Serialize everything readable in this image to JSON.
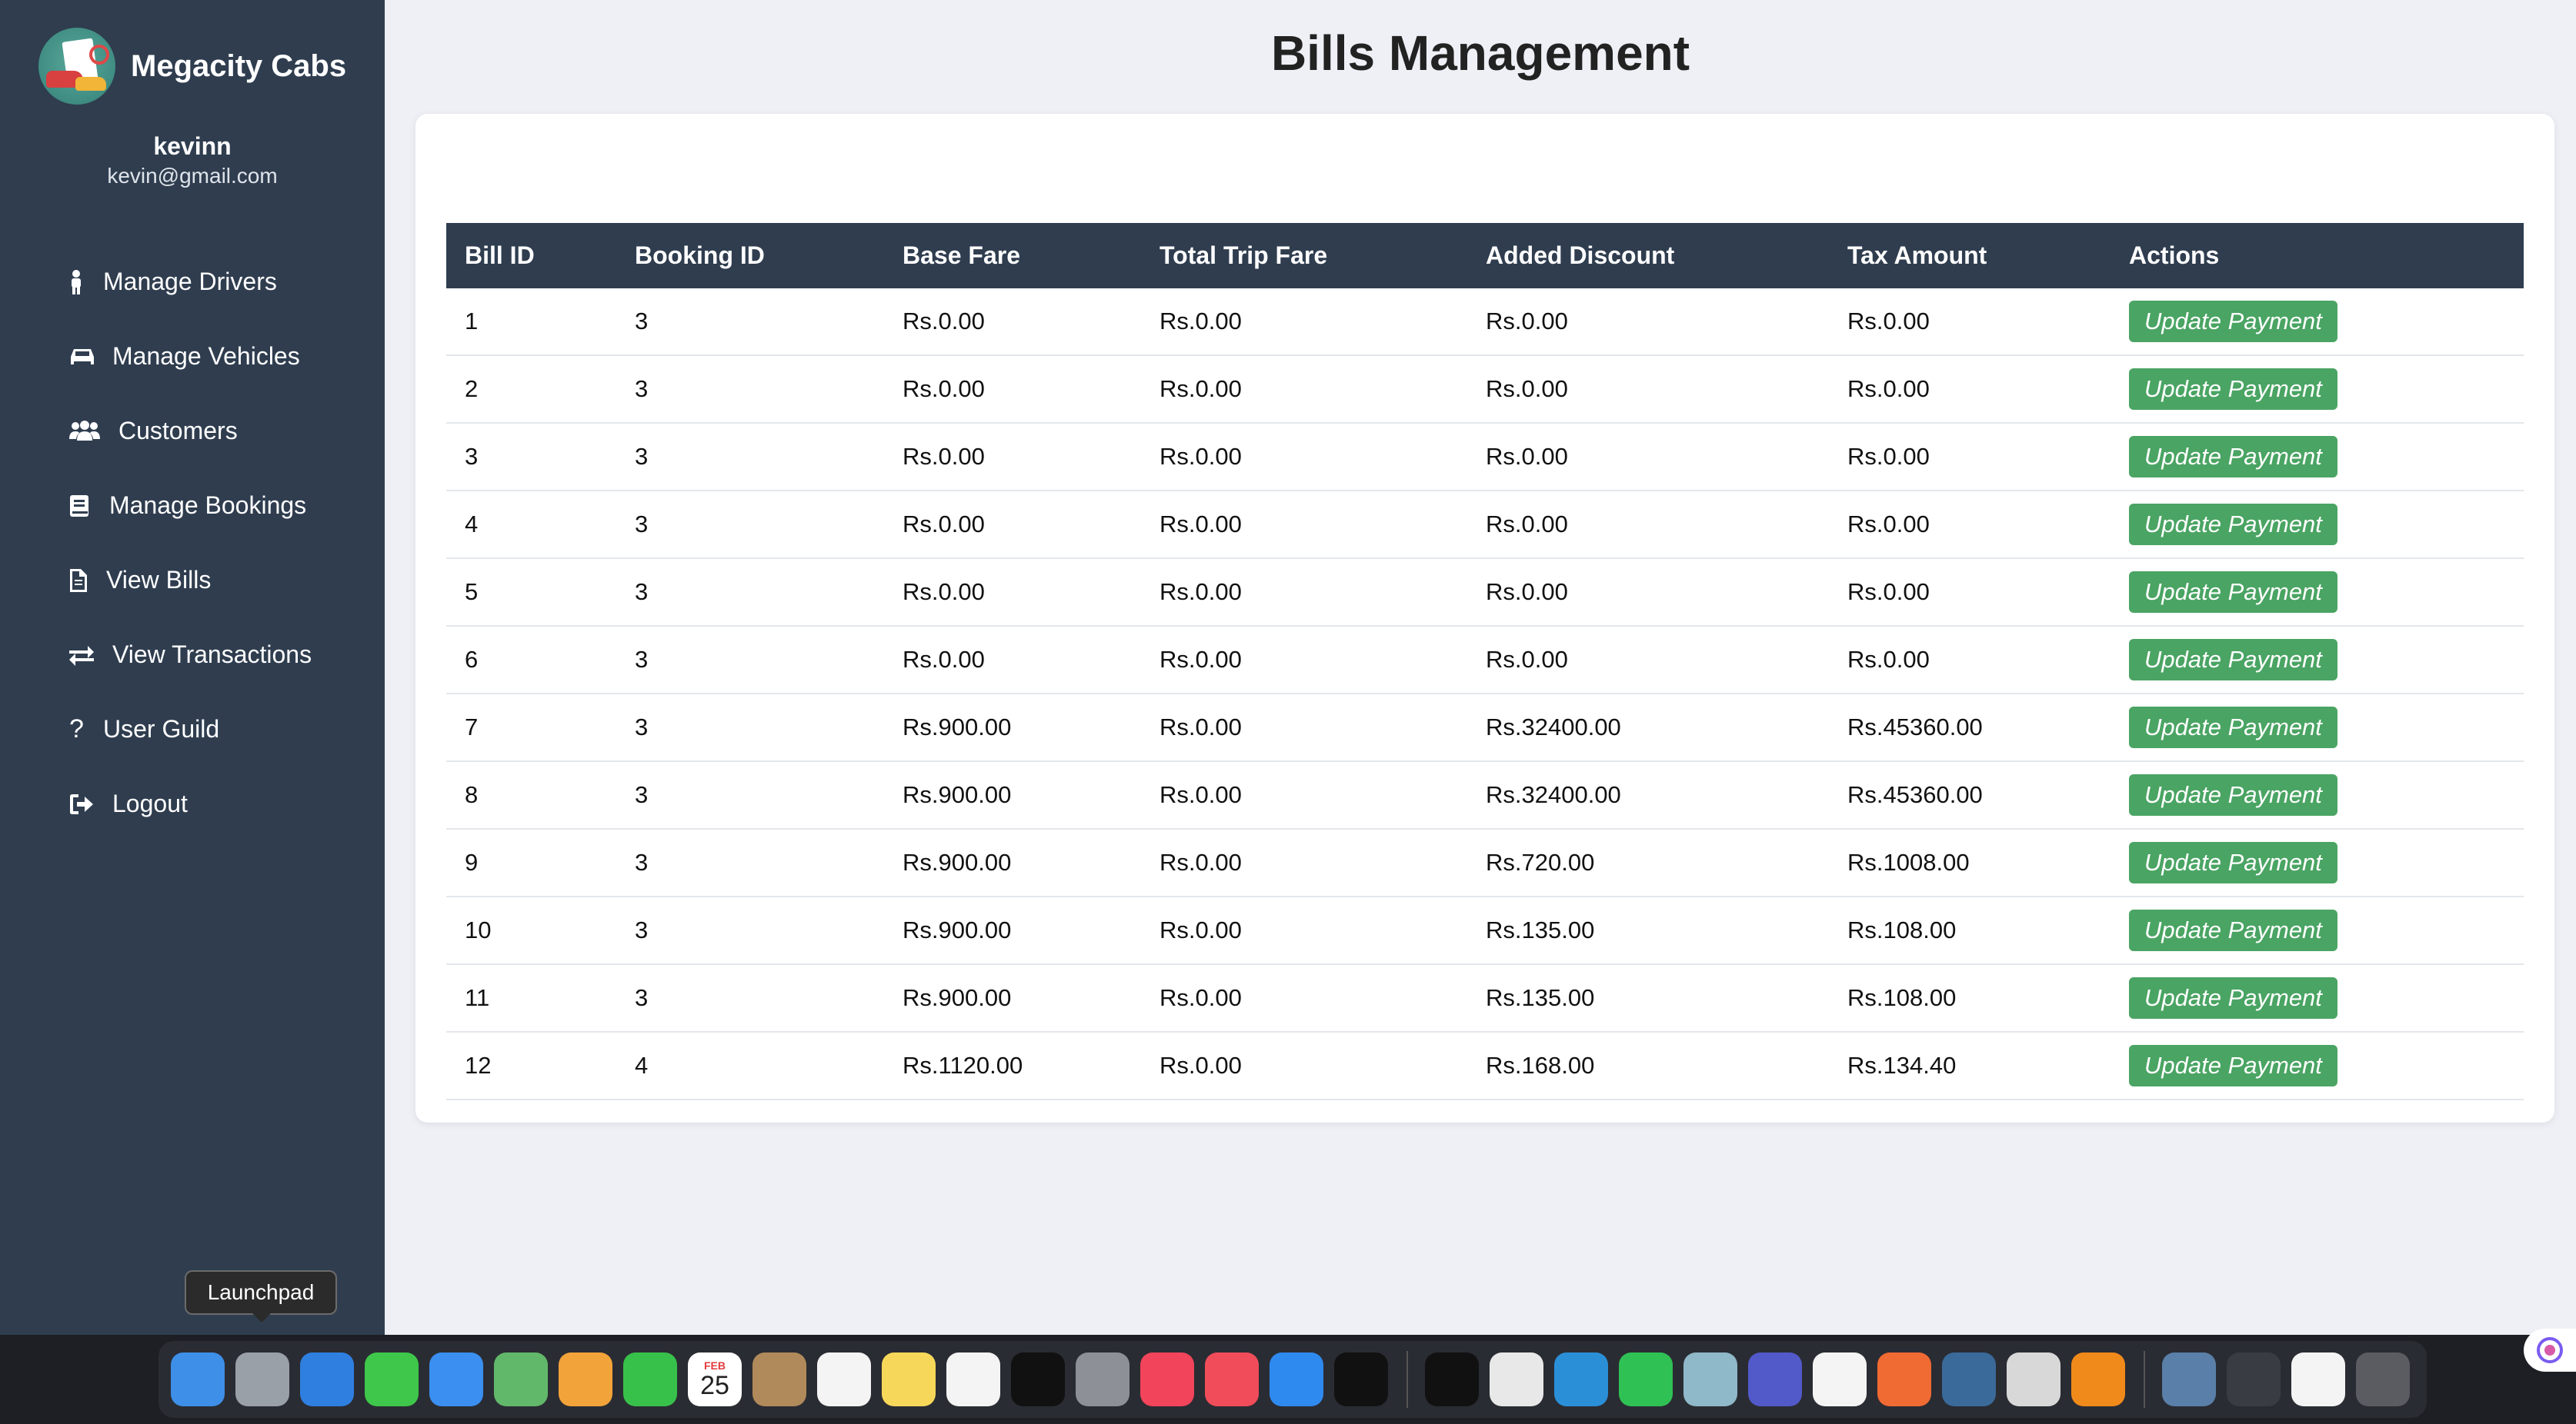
{
  "brand": {
    "name": "Megacity Cabs"
  },
  "user": {
    "name": "kevinn",
    "email": "kevin@gmail.com"
  },
  "nav": [
    {
      "label": "Manage Drivers",
      "icon": "person-icon"
    },
    {
      "label": "Manage Vehicles",
      "icon": "car-icon"
    },
    {
      "label": "Customers",
      "icon": "users-icon"
    },
    {
      "label": "Manage Bookings",
      "icon": "book-icon"
    },
    {
      "label": "View Bills",
      "icon": "file-icon"
    },
    {
      "label": "View Transactions",
      "icon": "exchange-icon"
    },
    {
      "label": "User Guild",
      "icon": "question-icon"
    },
    {
      "label": "Logout",
      "icon": "logout-icon"
    }
  ],
  "page": {
    "title": "Bills Management"
  },
  "table": {
    "headers": [
      "Bill ID",
      "Booking ID",
      "Base Fare",
      "Total Trip Fare",
      "Added Discount",
      "Tax Amount",
      "Actions"
    ],
    "action_label": "Update Payment",
    "rows": [
      [
        "1",
        "3",
        "Rs.0.00",
        "Rs.0.00",
        "Rs.0.00",
        "Rs.0.00"
      ],
      [
        "2",
        "3",
        "Rs.0.00",
        "Rs.0.00",
        "Rs.0.00",
        "Rs.0.00"
      ],
      [
        "3",
        "3",
        "Rs.0.00",
        "Rs.0.00",
        "Rs.0.00",
        "Rs.0.00"
      ],
      [
        "4",
        "3",
        "Rs.0.00",
        "Rs.0.00",
        "Rs.0.00",
        "Rs.0.00"
      ],
      [
        "5",
        "3",
        "Rs.0.00",
        "Rs.0.00",
        "Rs.0.00",
        "Rs.0.00"
      ],
      [
        "6",
        "3",
        "Rs.0.00",
        "Rs.0.00",
        "Rs.0.00",
        "Rs.0.00"
      ],
      [
        "7",
        "3",
        "Rs.900.00",
        "Rs.0.00",
        "Rs.32400.00",
        "Rs.45360.00"
      ],
      [
        "8",
        "3",
        "Rs.900.00",
        "Rs.0.00",
        "Rs.32400.00",
        "Rs.45360.00"
      ],
      [
        "9",
        "3",
        "Rs.900.00",
        "Rs.0.00",
        "Rs.720.00",
        "Rs.1008.00"
      ],
      [
        "10",
        "3",
        "Rs.900.00",
        "Rs.0.00",
        "Rs.135.00",
        "Rs.108.00"
      ],
      [
        "11",
        "3",
        "Rs.900.00",
        "Rs.0.00",
        "Rs.135.00",
        "Rs.108.00"
      ],
      [
        "12",
        "4",
        "Rs.1120.00",
        "Rs.0.00",
        "Rs.168.00",
        "Rs.134.40"
      ]
    ]
  },
  "tooltip": {
    "text": "Launchpad"
  },
  "dock": {
    "calendar_month": "FEB",
    "calendar_day": "25",
    "apps": [
      {
        "name": "finder-icon",
        "color": "#3d8fe8"
      },
      {
        "name": "launchpad-icon",
        "color": "#9aa0a8"
      },
      {
        "name": "safari-icon",
        "color": "#2f7fe0"
      },
      {
        "name": "messages-icon",
        "color": "#3ec74a"
      },
      {
        "name": "mail-icon",
        "color": "#3a8ff0"
      },
      {
        "name": "maps-icon",
        "color": "#62b86a"
      },
      {
        "name": "photos-icon",
        "color": "#f2a33a"
      },
      {
        "name": "facetime-icon",
        "color": "#38c14a"
      },
      {
        "name": "calendar-icon",
        "color": "#ffffff"
      },
      {
        "name": "contacts-icon",
        "color": "#b08a5a"
      },
      {
        "name": "reminders-icon",
        "color": "#f4f4f4"
      },
      {
        "name": "notes-icon",
        "color": "#f7d75a"
      },
      {
        "name": "freeform-icon",
        "color": "#f4f4f4"
      },
      {
        "name": "appletv-icon",
        "color": "#111111"
      },
      {
        "name": "system-settings-icon",
        "color": "#8d9096"
      },
      {
        "name": "music-icon",
        "color": "#f2445a"
      },
      {
        "name": "news-icon",
        "color": "#f14c5a"
      },
      {
        "name": "appstore-icon",
        "color": "#2f8af0"
      },
      {
        "name": "terminal-icon",
        "color": "#111111"
      }
    ],
    "apps2": [
      {
        "name": "cube-app-icon",
        "color": "#111111"
      },
      {
        "name": "chrome-icon",
        "color": "#e8e8e8"
      },
      {
        "name": "vscode-icon",
        "color": "#2b8fd8"
      },
      {
        "name": "whatsapp-icon",
        "color": "#2fc154"
      },
      {
        "name": "hexagon-app-icon",
        "color": "#8fb8c8"
      },
      {
        "name": "teams-icon",
        "color": "#5259c8"
      },
      {
        "name": "mongodb-icon",
        "color": "#f4f4f4"
      },
      {
        "name": "postman-icon",
        "color": "#f06a33"
      },
      {
        "name": "mysql-workbench-icon",
        "color": "#3a6a9a"
      },
      {
        "name": "sketch-tool-icon",
        "color": "#d8d8d8"
      },
      {
        "name": "vlc-icon",
        "color": "#f08a1a"
      }
    ],
    "apps3": [
      {
        "name": "document-stack-icon",
        "color": "#5a7fa8"
      },
      {
        "name": "window-thumbnail-icon",
        "color": "#3a3c44"
      },
      {
        "name": "window-thumbnail-icon",
        "color": "#f4f4f4"
      },
      {
        "name": "trash-icon",
        "color": "#5a5c62"
      }
    ]
  }
}
